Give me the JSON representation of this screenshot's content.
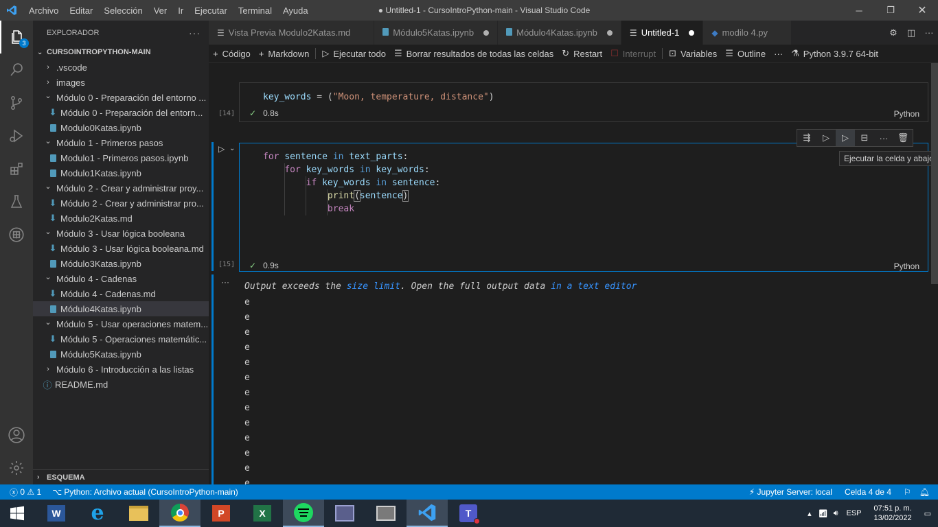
{
  "menu": [
    "Archivo",
    "Editar",
    "Selección",
    "Ver",
    "Ir",
    "Ejecutar",
    "Terminal",
    "Ayuda"
  ],
  "window_title": "● Untitled-1 - CursoIntroPython-main - Visual Studio Code",
  "activity_badge": "3",
  "sidebar": {
    "title": "EXPLORADOR",
    "section": "CURSOINTROPYTHON-MAIN",
    "items": [
      {
        "label": ".vscode",
        "kind": "folder",
        "open": false,
        "depth": 1
      },
      {
        "label": "images",
        "kind": "folder",
        "open": false,
        "depth": 1
      },
      {
        "label": "Módulo 0 - Preparación del entorno ...",
        "kind": "folder",
        "open": true,
        "depth": 1
      },
      {
        "label": "Módulo 0 - Preparación del entorn...",
        "kind": "md",
        "depth": 2
      },
      {
        "label": "Modulo0Katas.ipynb",
        "kind": "nb",
        "depth": 2
      },
      {
        "label": "Módulo 1 - Primeros pasos",
        "kind": "folder",
        "open": true,
        "depth": 1
      },
      {
        "label": "Modulo1 - Primeros pasos.ipynb",
        "kind": "nb",
        "depth": 2
      },
      {
        "label": "Modulo1Katas.ipynb",
        "kind": "nb",
        "depth": 2
      },
      {
        "label": "Módulo 2 - Crear y administrar proy...",
        "kind": "folder",
        "open": true,
        "depth": 1
      },
      {
        "label": "Módulo 2 - Crear y administrar pro...",
        "kind": "md",
        "depth": 2
      },
      {
        "label": "Modulo2Katas.md",
        "kind": "md",
        "depth": 2
      },
      {
        "label": "Módulo 3 - Usar lógica booleana",
        "kind": "folder",
        "open": true,
        "depth": 1
      },
      {
        "label": "Módulo 3 - Usar lógica booleana.md",
        "kind": "md",
        "depth": 2
      },
      {
        "label": "Módulo3Katas.ipynb",
        "kind": "nb",
        "depth": 2
      },
      {
        "label": "Módulo 4 - Cadenas",
        "kind": "folder",
        "open": true,
        "depth": 1
      },
      {
        "label": "Módulo 4 - Cadenas.md",
        "kind": "md",
        "depth": 2
      },
      {
        "label": "Módulo4Katas.ipynb",
        "kind": "nb",
        "depth": 2,
        "selected": true
      },
      {
        "label": "Módulo 5 - Usar operaciones matem...",
        "kind": "folder",
        "open": true,
        "depth": 1
      },
      {
        "label": "Módulo 5 - Operaciones matemátic...",
        "kind": "md",
        "depth": 2
      },
      {
        "label": "Módulo5Katas.ipynb",
        "kind": "nb",
        "depth": 2
      },
      {
        "label": "Módulo 6 - Introducción a las listas",
        "kind": "folder",
        "open": false,
        "depth": 1
      },
      {
        "label": "README.md",
        "kind": "info",
        "depth": 1
      }
    ],
    "outline_section": "ESQUEMA"
  },
  "tabs": [
    {
      "label": "Vista Previa Modulo2Katas.md",
      "icon": "preview-icon",
      "dot": false,
      "active": false
    },
    {
      "label": "Módulo5Katas.ipynb",
      "icon": "notebook-icon",
      "dot": true,
      "active": false
    },
    {
      "label": "Módulo4Katas.ipynb",
      "icon": "notebook-icon",
      "dot": true,
      "active": false
    },
    {
      "label": "Untitled-1",
      "icon": "notebook-icon",
      "dot": true,
      "active": true
    },
    {
      "label": "modilo 4.py",
      "icon": "python-icon",
      "dot": false,
      "active": false
    }
  ],
  "toolbar": {
    "code": "Código",
    "markdown": "Markdown",
    "run_all": "Ejecutar todo",
    "clear": "Borrar resultados de todas las celdas",
    "restart": "Restart",
    "interrupt": "Interrupt",
    "variables": "Variables",
    "outline": "Outline",
    "kernel": "Python 3.9.7 64-bit"
  },
  "cells": [
    {
      "exec": "[14]",
      "time": "0.8s",
      "lang": "Python",
      "code": "key_words = (\"Moon, temperature, distance\")"
    },
    {
      "exec": "[15]",
      "time": "0.9s",
      "lang": "Python",
      "lines": [
        "for sentence in text_parts:",
        "    for key_words in key_words:",
        "        if key_words in sentence:",
        "            print(sentence)",
        "            break"
      ]
    }
  ],
  "tooltip": "Ejecutar la celda y abajo",
  "output": {
    "prefix": "Output exceeds the ",
    "link1": "size limit",
    "middle": ". Open the full output data ",
    "link2": "in a text editor",
    "lines": [
      "e",
      "e",
      "e",
      "e",
      "e",
      "e",
      "e",
      "e",
      "e",
      "e",
      "e",
      "e",
      "e"
    ]
  },
  "status": {
    "errors": "0",
    "warnings": "1",
    "interpreter": "Python: Archivo actual (CursoIntroPython-main)",
    "jupyter": "Jupyter Server: local",
    "cell": "Celda 4 de 4"
  },
  "taskbar": {
    "apps": [
      "windows-start",
      "word",
      "internet-explorer",
      "file-explorer",
      "chrome",
      "powerpoint",
      "excel",
      "spotify",
      "app-generic",
      "network-app",
      "vscode",
      "teams"
    ],
    "lang": "ESP",
    "time": "07:51 p. m.",
    "date": "13/02/2022"
  }
}
